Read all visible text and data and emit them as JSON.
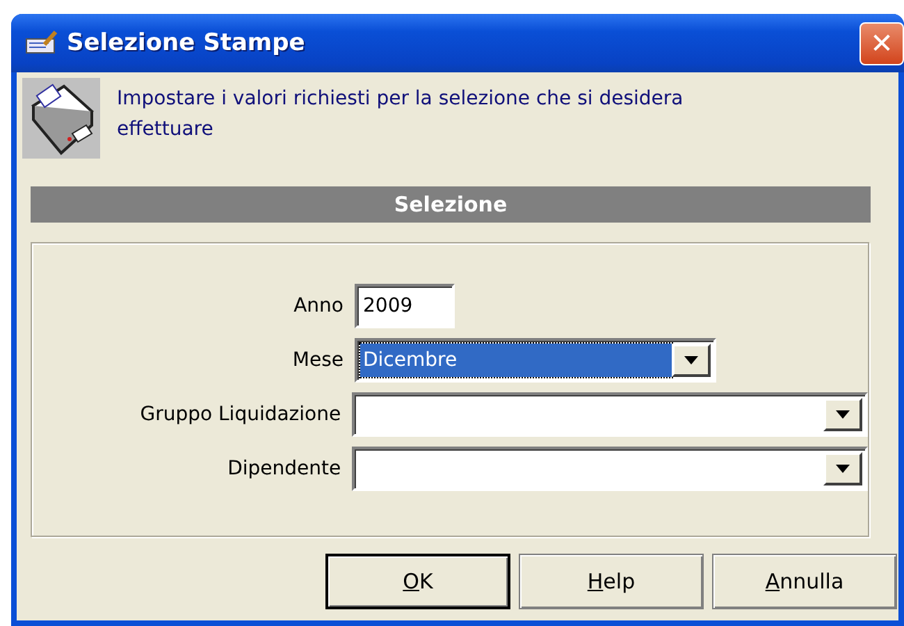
{
  "window": {
    "title": "Selezione Stampe",
    "close": "✕"
  },
  "header": {
    "text": "Impostare i valori richiesti per la selezione che si desidera effettuare"
  },
  "section": {
    "title": "Selezione"
  },
  "fields": [
    {
      "label": "Anno",
      "kind": "text",
      "value": "2009",
      "focused": false
    },
    {
      "label": "Mese",
      "kind": "select",
      "value": "Dicembre",
      "focused": true
    },
    {
      "label": "Gruppo Liquidazione",
      "kind": "select",
      "focused": false
    },
    {
      "label": "Dipendente",
      "kind": "select",
      "focused": false
    }
  ],
  "buttons": [
    {
      "mnemonic": "O",
      "rest": "K",
      "default": true
    },
    {
      "mnemonic": "H",
      "rest": "elp",
      "default": false
    },
    {
      "mnemonic": "A",
      "rest": "nnulla",
      "default": false
    }
  ]
}
